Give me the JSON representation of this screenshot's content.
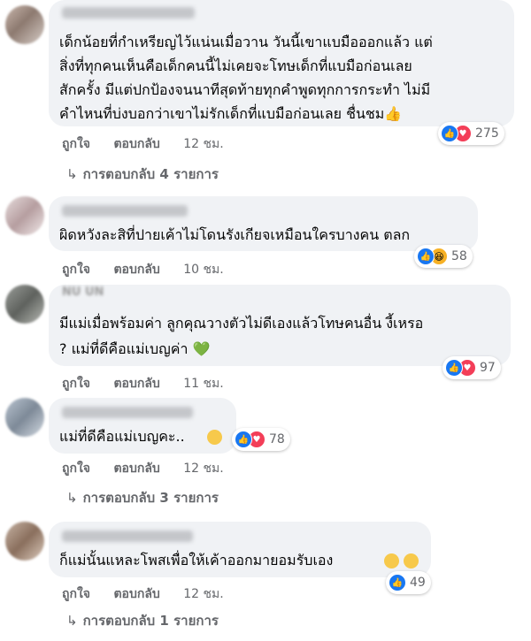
{
  "comments": [
    {
      "lines": [
        "เด็กน้อยที่กำเหรียญไว้แน่นเมื่อวาน วันนี้เขาแบมือออกแล้ว แต่",
        "สิ่งที่ทุกคนเห็นคือเด็กคนนี้ไม่เคยจะโทษเด็กที่แบมือก่อนเลย",
        "สักครั้ง มีแต่ปกป้องจนนาทีสุดท้ายทุกคำพูดทุกการกระทำ ไม่มี",
        "คำไหนที่บ่งบอกว่าเขาไม่รักเด็กที่แบมือก่อนเลย ชื่นชม👍"
      ],
      "like_label": "ถูกใจ",
      "reply_label": "ตอบกลับ",
      "time": "12 ชม.",
      "reaction_icons": [
        "like-icon",
        "love-icon"
      ],
      "reaction_count": "275",
      "replies_label": "การตอบกลับ 4 รายการ"
    },
    {
      "lines": [
        "ผิดหวังละสิที่ปายเค้าไม่โดนรังเกียจเหมือนใครบางคน ตลก"
      ],
      "like_label": "ถูกใจ",
      "reply_label": "ตอบกลับ",
      "time": "10 ชม.",
      "reaction_icons": [
        "like-icon",
        "haha-icon"
      ],
      "reaction_count": "58"
    },
    {
      "name_fragment": "NU UN",
      "lines": [
        "มีแม่เมื่อพร้อมค่า ลูกคุณวางตัวไม่ดีเองแล้วโทษคนอื่น งี้เหรอ",
        "? แม่ที่ดีคือแม่เบญค่า 💚"
      ],
      "like_label": "ถูกใจ",
      "reply_label": "ตอบกลับ",
      "time": "11 ชม.",
      "reaction_icons": [
        "like-icon",
        "love-icon"
      ],
      "reaction_count": "97"
    },
    {
      "lines": [
        "แม่ที่ดีคือแม่เบญคะ.."
      ],
      "like_label": "ถูกใจ",
      "reply_label": "ตอบกลับ",
      "time": "12 ชม.",
      "reaction_icons": [
        "like-icon",
        "love-icon"
      ],
      "reaction_count": "78",
      "replies_label": "การตอบกลับ 3 รายการ"
    },
    {
      "lines": [
        "ก็แม่นั้นแหละโพสเพื่อให้เค้าออกมายอมรับเอง"
      ],
      "like_label": "ถูกใจ",
      "reply_label": "ตอบกลับ",
      "time": "12 ชม.",
      "reaction_icons": [
        "like-icon"
      ],
      "reaction_count": "49",
      "replies_label": "การตอบกลับ 1 รายการ"
    }
  ],
  "colors": {
    "bubble": "#f0f2f5",
    "like": "#1877f2",
    "love": "#f33e58",
    "haha": "#f7b125",
    "meta": "#65676b"
  }
}
